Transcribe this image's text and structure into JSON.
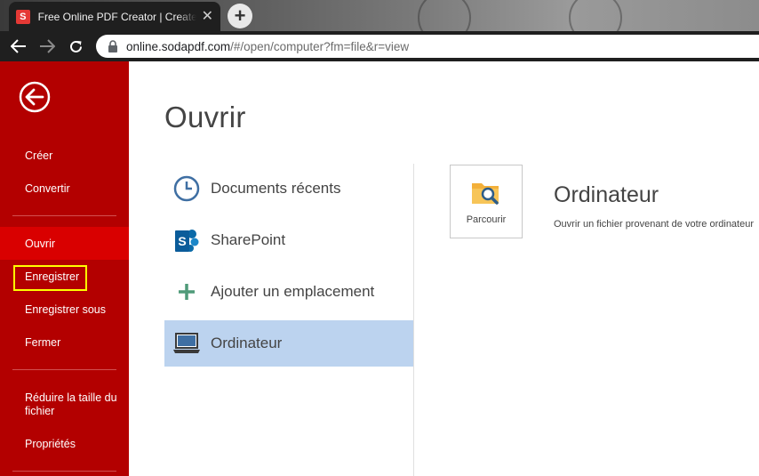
{
  "browser": {
    "tab_title": "Free Online PDF Creator | Create",
    "tab_favicon_letter": "S",
    "url_host": "online.sodapdf.com",
    "url_path": "/#/open/computer?fm=file&r=view"
  },
  "sidebar": {
    "group1": [
      {
        "label": "Créer"
      },
      {
        "label": "Convertir"
      }
    ],
    "group2": [
      {
        "label": "Ouvrir",
        "active": true
      },
      {
        "label": "Enregistrer",
        "highlighted": true
      },
      {
        "label": "Enregistrer sous"
      },
      {
        "label": "Fermer"
      }
    ],
    "group3": [
      {
        "label": "Réduire la taille du fichier"
      },
      {
        "label": "Propriétés"
      }
    ]
  },
  "main": {
    "title": "Ouvrir",
    "locations": [
      {
        "label": "Documents récents",
        "icon": "clock-icon"
      },
      {
        "label": "SharePoint",
        "icon": "sharepoint-icon"
      },
      {
        "label": "Ajouter un emplacement",
        "icon": "plus-icon"
      },
      {
        "label": "Ordinateur",
        "icon": "laptop-icon",
        "selected": true
      }
    ],
    "browse_label": "Parcourir",
    "detail_title": "Ordinateur",
    "detail_description": "Ouvrir un fichier provenant de votre ordinateur"
  },
  "colors": {
    "sidebar_bg": "#b30000",
    "sidebar_active": "#d90000",
    "highlight": "#ffff00",
    "selected_location": "#bcd3ef"
  }
}
